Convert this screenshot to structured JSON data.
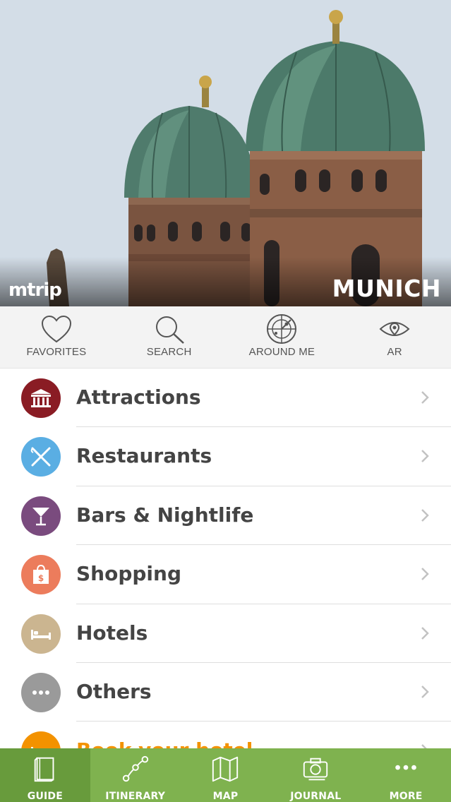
{
  "hero": {
    "brand": "mtrip",
    "city": "MUNICH"
  },
  "quick_actions": [
    {
      "label": "FAVORITES",
      "icon": "heart-icon"
    },
    {
      "label": "SEARCH",
      "icon": "search-icon"
    },
    {
      "label": "AROUND ME",
      "icon": "radar-icon"
    },
    {
      "label": "AR",
      "icon": "eye-icon"
    }
  ],
  "categories": [
    {
      "label": "Attractions",
      "icon": "museum-icon",
      "color": "#8a1c24"
    },
    {
      "label": "Restaurants",
      "icon": "cutlery-icon",
      "color": "#5aaee3"
    },
    {
      "label": "Bars & Nightlife",
      "icon": "cocktail-icon",
      "color": "#7a4b7e"
    },
    {
      "label": "Shopping",
      "icon": "shopping-bag-icon",
      "color": "#ec7c5c"
    },
    {
      "label": "Hotels",
      "icon": "bed-icon",
      "color": "#cbb590"
    },
    {
      "label": "Others",
      "icon": "more-dots-icon",
      "color": "#9a9a9a"
    },
    {
      "label": "Book your hotel",
      "icon": "bed-icon",
      "color": "#f39200"
    }
  ],
  "colors": {
    "accent_green": "#7fb24f",
    "active_tab": "#689b3c",
    "book_orange": "#f39200"
  },
  "tabs": [
    {
      "label": "GUIDE",
      "icon": "book-icon",
      "active": true
    },
    {
      "label": "ITINERARY",
      "icon": "route-icon",
      "active": false
    },
    {
      "label": "MAP",
      "icon": "map-icon",
      "active": false
    },
    {
      "label": "JOURNAL",
      "icon": "camera-icon",
      "active": false
    },
    {
      "label": "MORE",
      "icon": "more-dots-icon",
      "active": false
    }
  ]
}
